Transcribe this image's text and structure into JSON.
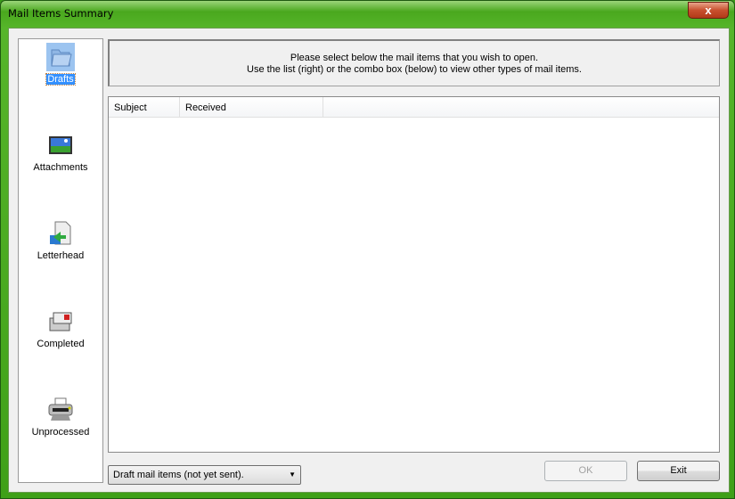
{
  "window": {
    "title": "Mail Items Summary",
    "close_label": "x"
  },
  "sidebar": {
    "items": [
      {
        "label": "Drafts",
        "icon": "drafts-folder-icon",
        "selected": true
      },
      {
        "label": "Attachments",
        "icon": "picture-attachment-icon",
        "selected": false
      },
      {
        "label": "Letterhead",
        "icon": "letterhead-document-icon",
        "selected": false
      },
      {
        "label": "Completed",
        "icon": "completed-mail-icon",
        "selected": false
      },
      {
        "label": "Unprocessed",
        "icon": "printer-icon",
        "selected": false
      }
    ]
  },
  "header": {
    "line1": "Please select below the mail items that you wish to open.",
    "line2": "Use the list (right) or the combo box (below) to view other types of mail items."
  },
  "list": {
    "columns": [
      "Subject",
      "Received"
    ],
    "rows": []
  },
  "combo": {
    "value": "Draft mail items (not yet sent)."
  },
  "buttons": {
    "ok": "OK",
    "exit": "Exit"
  }
}
